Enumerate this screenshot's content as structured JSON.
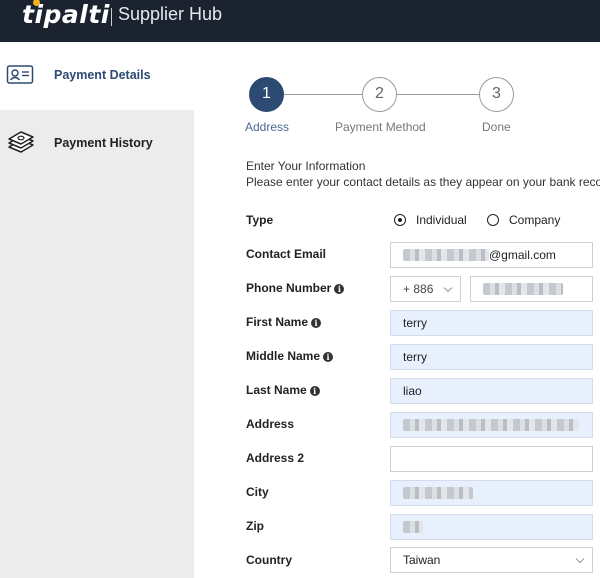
{
  "header": {
    "brand": "tipalti",
    "subtitle": "Supplier Hub"
  },
  "sidebar": {
    "items": [
      {
        "label": "Payment Details",
        "icon": "id-card-icon"
      },
      {
        "label": "Payment History",
        "icon": "money-stack-icon"
      }
    ]
  },
  "stepper": {
    "steps": [
      {
        "number": "1",
        "label": "Address"
      },
      {
        "number": "2",
        "label": "Payment Method"
      },
      {
        "number": "3",
        "label": "Done"
      }
    ],
    "active_step": 1
  },
  "form": {
    "intro_title": "Enter Your Information",
    "intro_text": "Please enter your contact details as they appear on your bank records",
    "type": {
      "label": "Type",
      "options": [
        "Individual",
        "Company"
      ],
      "selected": "Individual"
    },
    "contact_email": {
      "label": "Contact Email",
      "value_suffix": "@gmail.com"
    },
    "phone": {
      "label": "Phone Number",
      "country_code": "+ 886"
    },
    "first_name": {
      "label": "First Name",
      "value": "terry"
    },
    "middle_name": {
      "label": "Middle Name",
      "value": "terry"
    },
    "last_name": {
      "label": "Last Name",
      "value": "liao"
    },
    "address": {
      "label": "Address"
    },
    "address2": {
      "label": "Address 2",
      "value": ""
    },
    "city": {
      "label": "City"
    },
    "zip": {
      "label": "Zip"
    },
    "country": {
      "label": "Country",
      "value": "Taiwan"
    }
  },
  "colors": {
    "topbar": "#1b2330",
    "accent": "#2c4a72",
    "filled_field": "#e8f0fe",
    "sidebar_inactive": "#ececec"
  }
}
